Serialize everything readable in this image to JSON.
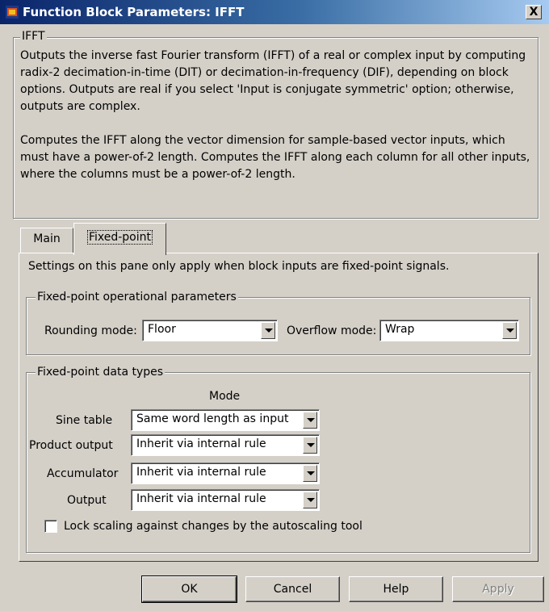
{
  "window": {
    "title": "Function Block Parameters: IFFT",
    "close_label": "X"
  },
  "block": {
    "name": "IFFT",
    "description": [
      "Outputs the inverse fast Fourier transform (IFFT) of a real or complex input by computing radix-2 decimation-in-time (DIT) or decimation-in-frequency (DIF), depending on block options. Outputs are real if you select 'Input is conjugate symmetric' option; otherwise, outputs are complex.",
      "Computes the IFFT along the vector dimension for sample-based vector inputs, which must have a power-of-2 length. Computes the IFFT along each column for all other inputs, where the columns must be a power-of-2 length."
    ]
  },
  "tabs": [
    {
      "label": "Main",
      "active": false
    },
    {
      "label": "Fixed-point",
      "active": true
    }
  ],
  "pane": {
    "note": "Settings on this pane only apply when block inputs are fixed-point signals.",
    "operational": {
      "title": "Fixed-point operational parameters",
      "rounding_label": "Rounding mode:",
      "rounding_value": "Floor",
      "overflow_label": "Overflow mode:",
      "overflow_value": "Wrap"
    },
    "datatypes": {
      "title": "Fixed-point data types",
      "mode_header": "Mode",
      "rows": [
        {
          "label": "Sine table",
          "value": "Same word length as input"
        },
        {
          "label": "Product output",
          "value": "Inherit via internal rule"
        },
        {
          "label": "Accumulator",
          "value": "Inherit via internal rule"
        },
        {
          "label": "Output",
          "value": "Inherit via internal rule"
        }
      ],
      "lock_label": "Lock scaling against changes by the autoscaling tool",
      "lock_checked": false
    }
  },
  "buttons": {
    "ok": "OK",
    "cancel": "Cancel",
    "help": "Help",
    "apply": "Apply"
  }
}
